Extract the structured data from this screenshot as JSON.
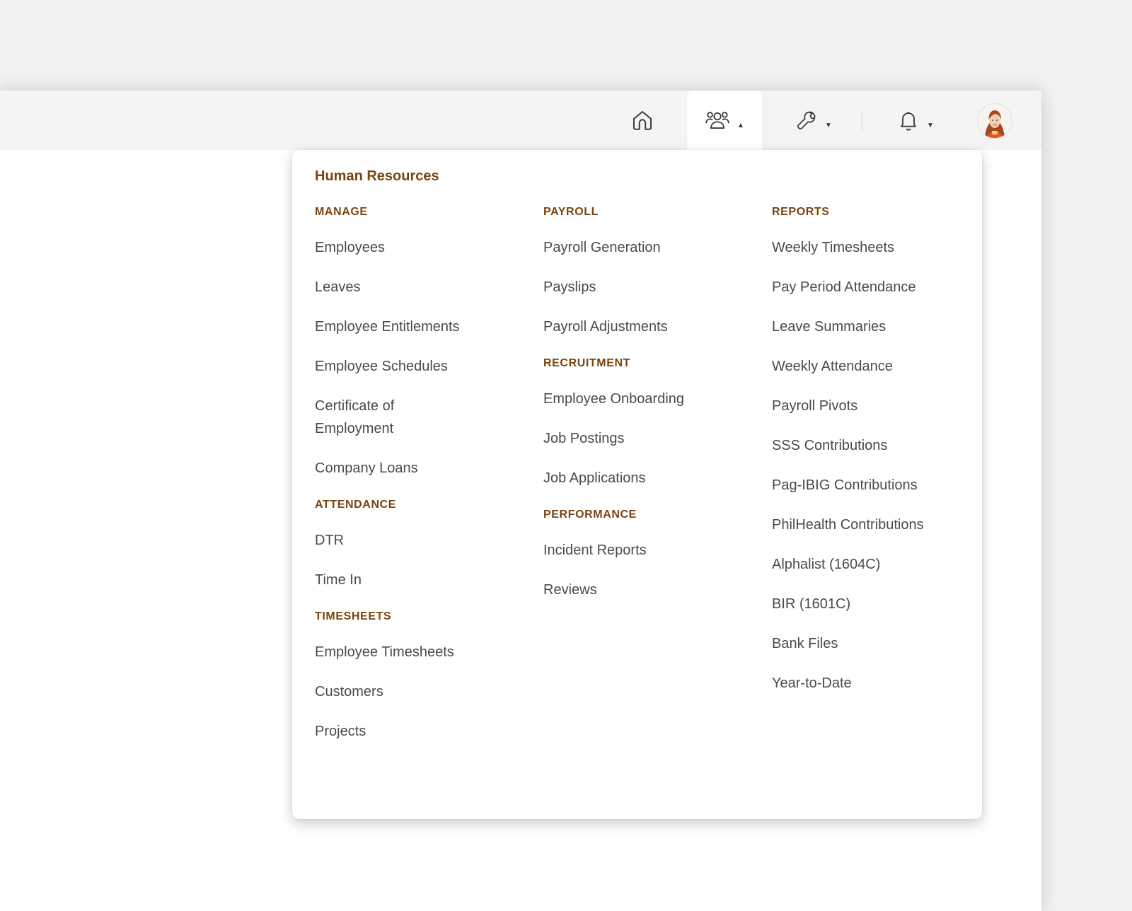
{
  "nav": {
    "icons": [
      "home-icon",
      "users-icon",
      "wrench-icon",
      "bell-icon"
    ],
    "caret_up": "▲",
    "caret_down": "▼"
  },
  "dropdown": {
    "title": "Human Resources",
    "manage": {
      "heading": "MANAGE",
      "items": [
        "Employees",
        "Leaves",
        "Employee Entitlements",
        "Employee Schedules",
        "Certificate of Employment",
        "Company Loans"
      ]
    },
    "attendance": {
      "heading": "ATTENDANCE",
      "items": [
        "DTR",
        "Time In"
      ]
    },
    "timesheets": {
      "heading": "TIMESHEETS",
      "items": [
        "Employee Timesheets",
        "Customers",
        "Projects"
      ]
    },
    "payroll": {
      "heading": "PAYROLL",
      "items": [
        "Payroll Generation",
        "Payslips",
        "Payroll Adjustments"
      ]
    },
    "recruitment": {
      "heading": "RECRUITMENT",
      "items": [
        "Employee Onboarding",
        "Job Postings",
        "Job Applications"
      ]
    },
    "performance": {
      "heading": "PERFORMANCE",
      "items": [
        "Incident Reports",
        "Reviews"
      ]
    },
    "reports": {
      "heading": "REPORTS",
      "items": [
        "Weekly Timesheets",
        "Pay Period Attendance",
        "Leave Summaries",
        "Weekly Attendance",
        "Payroll Pivots",
        "SSS Contributions",
        "Pag-IBIG Contributions",
        "PhilHealth Contributions",
        "Alphalist (1604C)",
        "BIR (1601C)",
        "Bank Files",
        "Year-to-Date"
      ]
    }
  },
  "colors": {
    "accent": "#7a4410",
    "link_text": "#4a4a4a",
    "topbar_bg": "#f4f4f4"
  }
}
